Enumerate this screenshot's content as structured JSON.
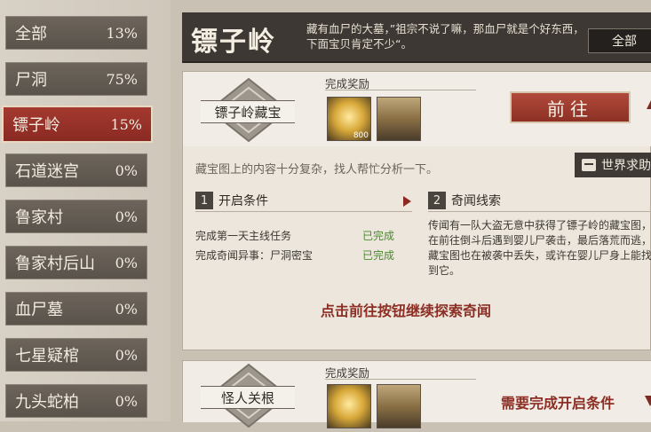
{
  "sidebar": {
    "items": [
      {
        "label": "全部",
        "pct": "13%"
      },
      {
        "label": "尸洞",
        "pct": "75%"
      },
      {
        "label": "镖子岭",
        "pct": "15%"
      },
      {
        "label": "石道迷宫",
        "pct": "0%"
      },
      {
        "label": "鲁家村",
        "pct": "0%"
      },
      {
        "label": "鲁家村后山",
        "pct": "0%"
      },
      {
        "label": "血尸墓",
        "pct": "0%"
      },
      {
        "label": "七星疑棺",
        "pct": "0%"
      },
      {
        "label": "九头蛇柏",
        "pct": "0%"
      }
    ],
    "active_index": 2
  },
  "header": {
    "title": "镖子岭",
    "description": "藏有血尸的大墓，”祖宗不说了嘛，那血尸就是个好东西，下面宝贝肯定不少“。",
    "filter_label": "全部"
  },
  "task1": {
    "name": "镖子岭藏宝",
    "reward_title": "完成奖励",
    "reward_count": "800",
    "go_label": "前往",
    "description": "藏宝图上的内容十分复杂，找人帮忙分析一下。",
    "help_label": "世界求助",
    "section1": {
      "num": "1",
      "title": "开启条件"
    },
    "section2": {
      "num": "2",
      "title": "奇闻线索"
    },
    "conditions": [
      {
        "text": "完成第一天主线任务",
        "status": "已完成"
      },
      {
        "text": "完成奇闻异事：尸洞密宝",
        "status": "已完成"
      }
    ],
    "clue": "传闻有一队大盗无意中获得了镖子岭的藏宝图，在前往倒斗后遇到婴儿尸袭击，最后落荒而逃，藏宝图也在被袭中丢失，或许在婴儿尸身上能找到它。",
    "hint": "点击前往按钮继续探索奇闻"
  },
  "task2": {
    "name": "怪人关根",
    "reward_title": "完成奖励",
    "status": "需要完成开启条件"
  },
  "colors": {
    "accent": "#8c2e24",
    "done": "#4c8a2f",
    "header_bg": "#3d3833"
  }
}
